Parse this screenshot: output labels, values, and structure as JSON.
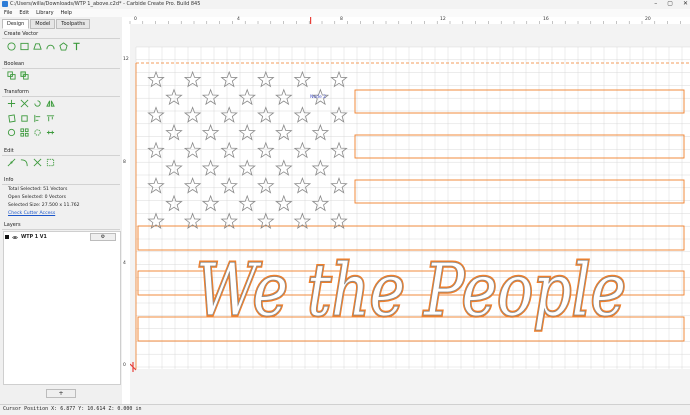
{
  "window": {
    "title": "C:/Users/willa/Downloads/WTP 1_above.c2d* - Carbide Create Pro. Build 845",
    "controls": [
      "–",
      "▢",
      "✕"
    ]
  },
  "menu": [
    "File",
    "Edit",
    "Library",
    "Help"
  ],
  "tabs": [
    "Design",
    "Model",
    "Toolpaths"
  ],
  "active_tab": "Design",
  "sections": {
    "create_vector": "Create Vector",
    "boolean": "Boolean",
    "transform": "Transform",
    "edit": "Edit",
    "info": "Info",
    "layers": "Layers"
  },
  "info": {
    "total_selected": "Total Selected:  51 Vectors",
    "open_selected": "Open Selected:  0 Vectors",
    "selected_size": "Selected Size:   27.500 x 11.762",
    "check_cutter": "Check Cutter Access"
  },
  "layers": [
    {
      "name": "WTP 1 V1",
      "color": "#111111",
      "gear": "⚙"
    }
  ],
  "add_layer_label": "+",
  "ruler": {
    "top": [
      "0",
      "4",
      "8",
      "12",
      "16",
      "20"
    ],
    "left": [
      "12",
      "8",
      "4",
      "0"
    ]
  },
  "canvas": {
    "wording": "We the People",
    "grid_color": "#d9d9d9",
    "path_color": "#f07f2a",
    "vector_color": "#8a8a8a",
    "marker_color": "#e8413a",
    "star_count": 50
  },
  "status": "Cursor Position X: 6.877 Y: 10.614 Z: 0.000 in"
}
